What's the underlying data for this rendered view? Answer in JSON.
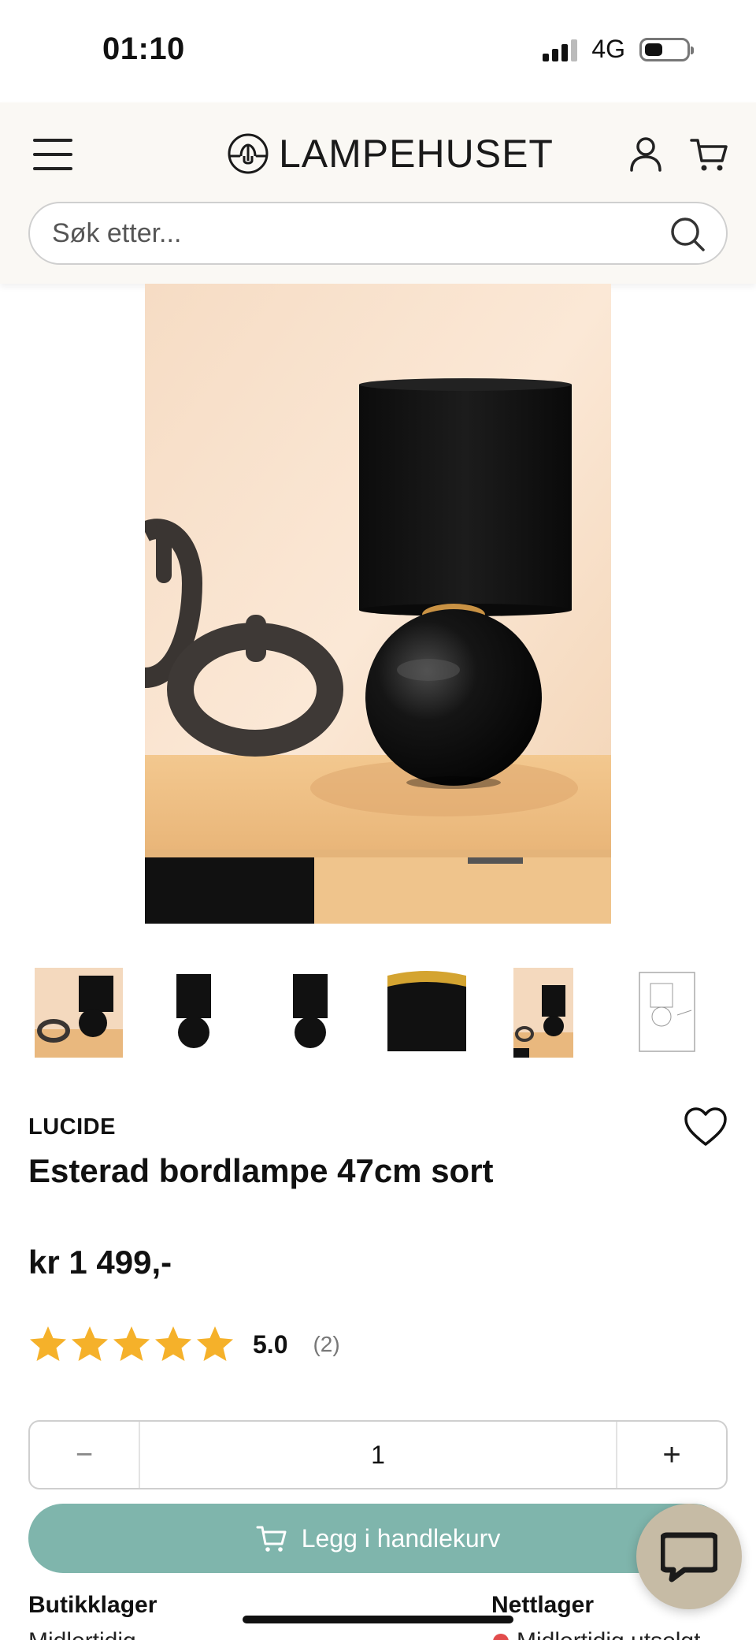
{
  "status_bar": {
    "time": "01:10",
    "network": "4G"
  },
  "header": {
    "logo_text": "LAMPEHUSET",
    "search_placeholder": "Søk etter..."
  },
  "product": {
    "brand": "LUCIDE",
    "title": "Esterad bordlampe 47cm sort",
    "price": "kr 1 499,-",
    "rating_value": "5.0",
    "rating_count": "(2)",
    "stars": 5,
    "quantity": "1"
  },
  "actions": {
    "minus_label": "−",
    "plus_label": "+",
    "add_to_cart": "Legg i handlekurv"
  },
  "stock": {
    "store_label": "Butikklager",
    "store_status": "Midlertidig",
    "web_label": "Nettlager",
    "web_status": "Midlertidig utsolgt"
  },
  "colors": {
    "accent": "#7fb5ac",
    "header_bg": "#faf8f4",
    "chat_bg": "#c6bba5",
    "star": "#f5b12a"
  }
}
